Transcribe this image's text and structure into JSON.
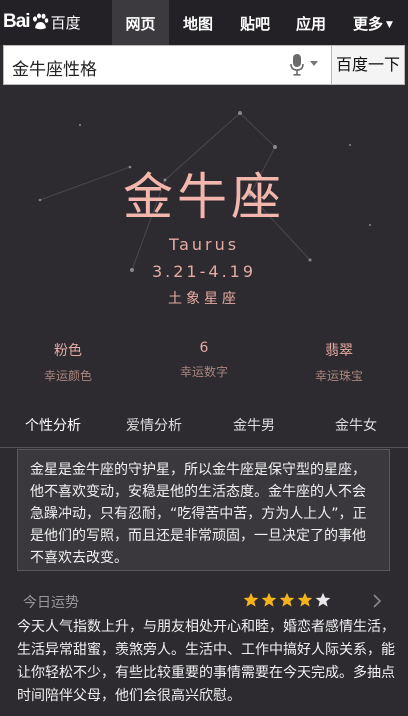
{
  "brand": {
    "logo_text": "Bai",
    "logo_cn": "百度",
    "paw_icon": "baidu-paw-icon"
  },
  "nav": {
    "tabs": [
      {
        "label": "网页",
        "active": true
      },
      {
        "label": "地图",
        "active": false
      },
      {
        "label": "贴吧",
        "active": false
      },
      {
        "label": "应用",
        "active": false
      },
      {
        "label": "更多",
        "active": false
      }
    ]
  },
  "search": {
    "query": "金牛座性格",
    "button_label": "百度一下",
    "mic_icon": "microphone-icon"
  },
  "sign": {
    "name": "金牛座",
    "name_en": "Taurus",
    "dates": "3.21-4.19",
    "element": "土象星座"
  },
  "lucky": [
    {
      "value": "粉色",
      "label": "幸运颜色"
    },
    {
      "value": "6",
      "label": "幸运数字"
    },
    {
      "value": "翡翠",
      "label": "幸运珠宝"
    }
  ],
  "tabs": [
    {
      "label": "个性分析",
      "active": true
    },
    {
      "label": "爱情分析",
      "active": false
    },
    {
      "label": "金牛男",
      "active": false
    },
    {
      "label": "金牛女",
      "active": false
    }
  ],
  "description": "金星是金牛座的守护星，所以金牛座是保守型的星座，他不喜欢变动，安稳是他的生活态度。金牛座的人不会急躁冲动，只有忍耐，“吃得苦中苦，方为人上人”，正是他们的写照，而且还是非常顽固，一旦决定了的事他不喜欢去改变。",
  "today": {
    "title": "今日运势",
    "rating": 4,
    "rating_max": 5,
    "star_color": "#f5b31b",
    "text": "今天人气指数上升，与朋友相处开心和睦，婚恋者感情生活，生活异常甜蜜，羡煞旁人。生活中、工作中搞好人际关系，能让你轻松不少，有些比较重要的事情需要在今天完成。多抽点时间陪伴父母，他们会很高兴欣慰。"
  },
  "colors": {
    "accent": "#f3b6ad",
    "background": "#2d2b30",
    "topbar": "#232125"
  }
}
